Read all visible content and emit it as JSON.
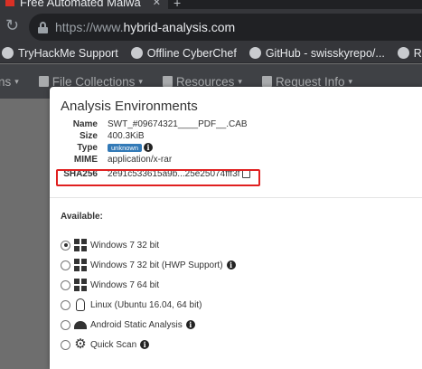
{
  "browser": {
    "tab_title": "Free Automated Malwa",
    "new_tab_label": "+",
    "url_prefix": "https://www.",
    "url_domain": "hybrid-analysis.com",
    "bookmarks": [
      {
        "label": "TryHackMe Support",
        "icon": "globe-icon"
      },
      {
        "label": "Offline CyberChef",
        "icon": "chef-hat-icon"
      },
      {
        "label": "GitHub - swisskyrepo/...",
        "icon": "github-icon"
      },
      {
        "label": "Reverse Sh",
        "icon": "globe-icon"
      }
    ]
  },
  "site_nav": {
    "items": [
      {
        "label": "ns",
        "icon": "none"
      },
      {
        "label": "File Collections",
        "icon": "file-icon"
      },
      {
        "label": "Resources",
        "icon": "folder-icon"
      },
      {
        "label": "Request Info",
        "icon": "question-icon"
      }
    ]
  },
  "modal": {
    "title": "Analysis Environments",
    "meta": {
      "name_key": "Name",
      "name_val": "SWT_#09674321____PDF__.CAB",
      "size_key": "Size",
      "size_val": "400.3KiB",
      "type_key": "Type",
      "type_val": "unknown",
      "mime_key": "MIME",
      "mime_val": "application/x-rar",
      "sha_key": "SHA256",
      "sha_val": "2e91c533615a9b...25e25074fff3f"
    },
    "available_label": "Available:",
    "environments": [
      {
        "label": "Windows 7 32 bit",
        "icon": "windows-icon",
        "selected": true,
        "info": false
      },
      {
        "label": "Windows 7 32 bit (HWP Support)",
        "icon": "windows-icon",
        "selected": false,
        "info": true
      },
      {
        "label": "Windows 7 64 bit",
        "icon": "windows-icon",
        "selected": false,
        "info": false
      },
      {
        "label": "Linux (Ubuntu 16.04, 64 bit)",
        "icon": "linux-icon",
        "selected": false,
        "info": false
      },
      {
        "label": "Android Static Analysis",
        "icon": "android-icon",
        "selected": false,
        "info": true
      },
      {
        "label": "Quick Scan",
        "icon": "gear-icon",
        "selected": false,
        "info": true
      }
    ]
  },
  "colors": {
    "highlight": "#e02020",
    "badge": "#337ab7"
  }
}
